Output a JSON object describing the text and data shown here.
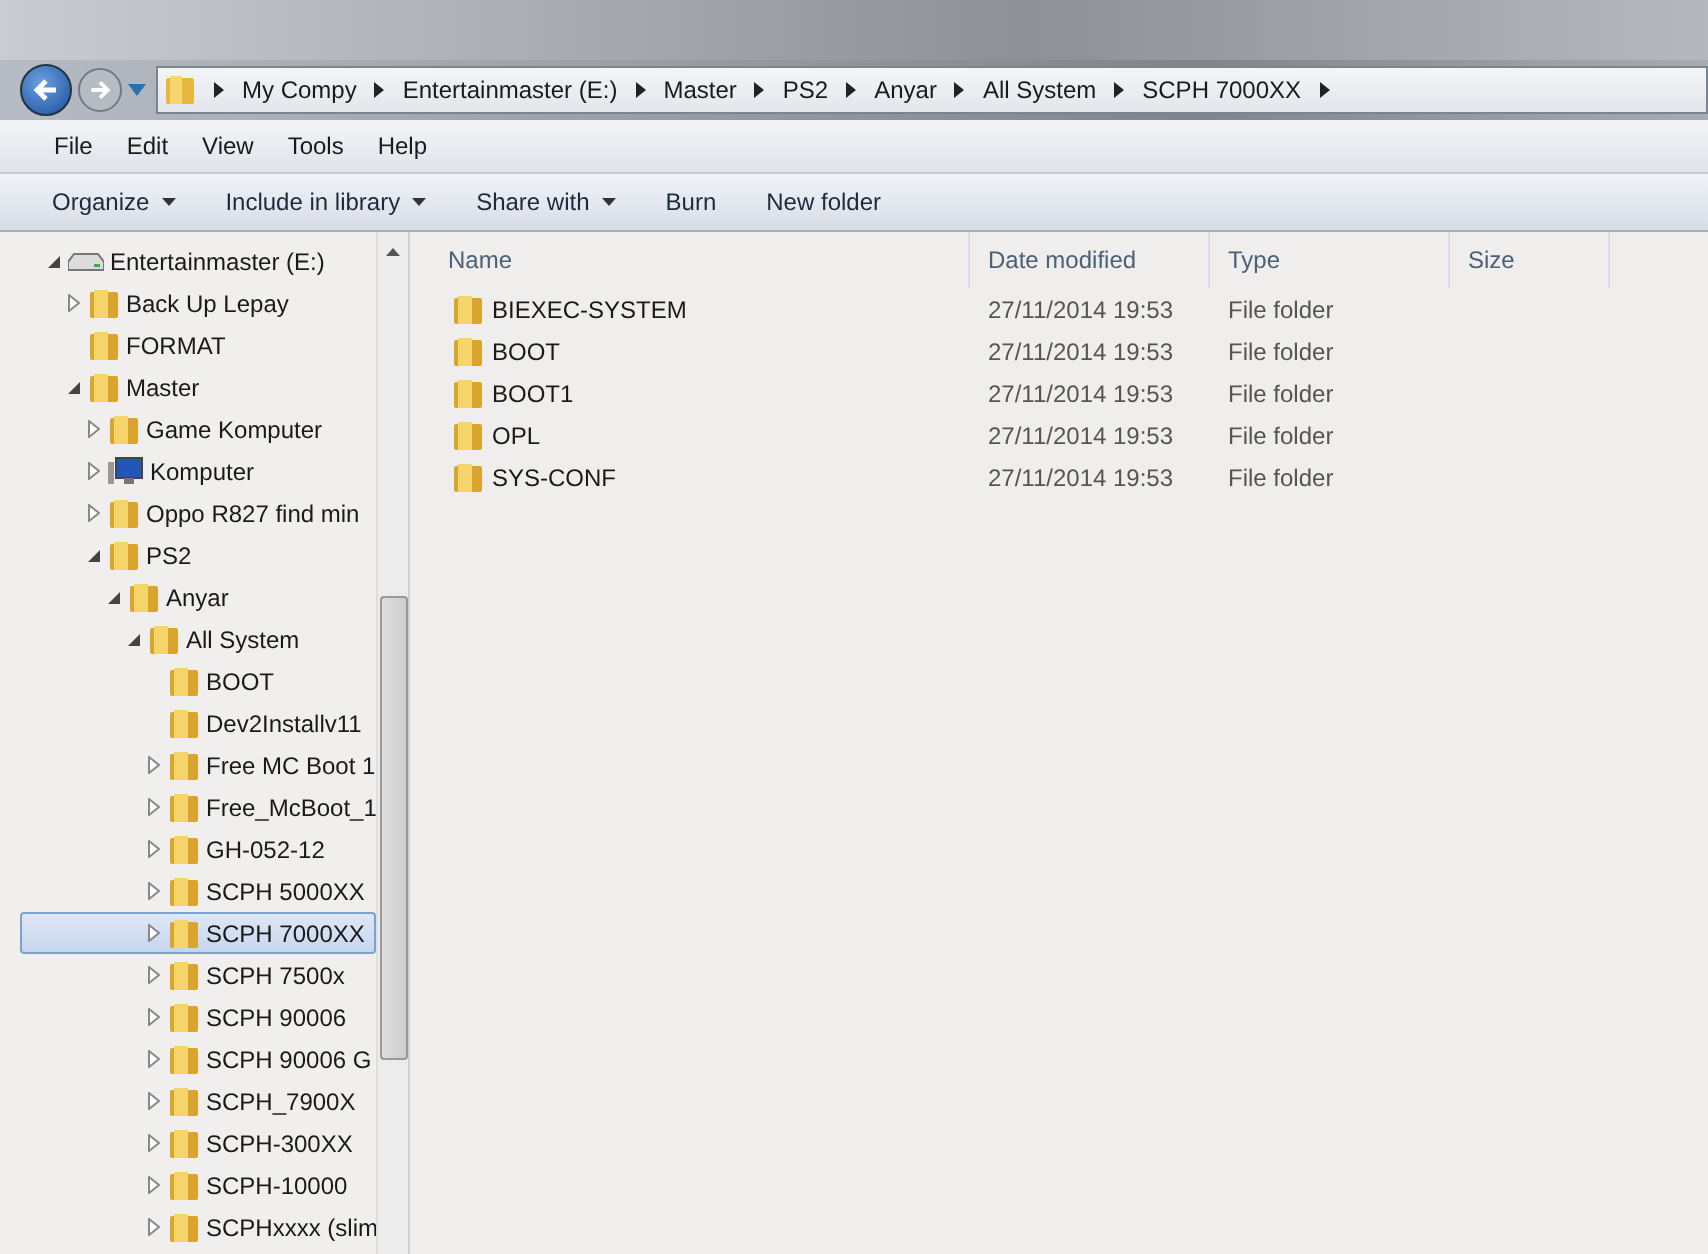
{
  "address_bar": {
    "crumbs": [
      "My Compy",
      "Entertainmaster (E:)",
      "Master",
      "PS2",
      "Anyar",
      "All System",
      "SCPH 7000XX"
    ]
  },
  "menu_bar": [
    "File",
    "Edit",
    "View",
    "Tools",
    "Help"
  ],
  "toolbar": [
    {
      "label": "Organize",
      "dropdown": true
    },
    {
      "label": "Include in library",
      "dropdown": true
    },
    {
      "label": "Share with",
      "dropdown": true
    },
    {
      "label": "Burn",
      "dropdown": false
    },
    {
      "label": "New folder",
      "dropdown": false
    }
  ],
  "tree": [
    {
      "label": "Entertainmaster (E:)",
      "kind": "drive",
      "expanded": true,
      "selected": false,
      "children": [
        {
          "label": "Back Up Lepay",
          "kind": "folder",
          "expanded": false,
          "selected": false
        },
        {
          "label": "FORMAT",
          "kind": "folder",
          "selected": false
        },
        {
          "label": "Master",
          "kind": "folder",
          "expanded": true,
          "selected": false,
          "children": [
            {
              "label": "Game Komputer",
              "kind": "folder",
              "expanded": false,
              "selected": false
            },
            {
              "label": "Komputer",
              "kind": "computer",
              "expanded": false,
              "selected": false
            },
            {
              "label": "Oppo R827 find min",
              "kind": "folder",
              "expanded": false,
              "selected": false
            },
            {
              "label": "PS2",
              "kind": "folder",
              "expanded": true,
              "selected": false,
              "children": [
                {
                  "label": "Anyar",
                  "kind": "folder",
                  "expanded": true,
                  "selected": false,
                  "children": [
                    {
                      "label": "All System",
                      "kind": "folder",
                      "expanded": true,
                      "selected": false,
                      "children": [
                        {
                          "label": "BOOT",
                          "kind": "folder",
                          "selected": false
                        },
                        {
                          "label": "Dev2Installv11",
                          "kind": "folder",
                          "selected": false
                        },
                        {
                          "label": "Free MC Boot 1",
                          "kind": "folder",
                          "expanded": false,
                          "selected": false
                        },
                        {
                          "label": "Free_McBoot_1",
                          "kind": "folder",
                          "expanded": false,
                          "selected": false
                        },
                        {
                          "label": "GH-052-12",
                          "kind": "folder",
                          "expanded": false,
                          "selected": false
                        },
                        {
                          "label": "SCPH 5000XX",
                          "kind": "folder",
                          "expanded": false,
                          "selected": false
                        },
                        {
                          "label": "SCPH 7000XX",
                          "kind": "folder",
                          "expanded": false,
                          "selected": true
                        },
                        {
                          "label": "SCPH 7500x",
                          "kind": "folder",
                          "expanded": false,
                          "selected": false
                        },
                        {
                          "label": "SCPH 90006",
                          "kind": "folder",
                          "expanded": false,
                          "selected": false
                        },
                        {
                          "label": "SCPH 90006 G",
                          "kind": "folder",
                          "expanded": false,
                          "selected": false
                        },
                        {
                          "label": "SCPH_7900X",
                          "kind": "folder",
                          "expanded": false,
                          "selected": false
                        },
                        {
                          "label": "SCPH-300XX",
                          "kind": "folder",
                          "expanded": false,
                          "selected": false
                        },
                        {
                          "label": "SCPH-10000",
                          "kind": "folder",
                          "expanded": false,
                          "selected": false
                        },
                        {
                          "label": "SCPHxxxx (slim",
                          "kind": "folder",
                          "expanded": false,
                          "selected": false
                        }
                      ]
                    }
                  ]
                }
              ]
            }
          ]
        }
      ]
    }
  ],
  "file_list": {
    "columns": [
      "Name",
      "Date modified",
      "Type",
      "Size"
    ],
    "rows": [
      {
        "name": "BIEXEC-SYSTEM",
        "date_modified": "27/11/2014 19:53",
        "type": "File folder"
      },
      {
        "name": "BOOT",
        "date_modified": "27/11/2014 19:53",
        "type": "File folder"
      },
      {
        "name": "BOOT1",
        "date_modified": "27/11/2014 19:53",
        "type": "File folder"
      },
      {
        "name": "OPL",
        "date_modified": "27/11/2014 19:53",
        "type": "File folder"
      },
      {
        "name": "SYS-CONF",
        "date_modified": "27/11/2014 19:53",
        "type": "File folder"
      }
    ]
  }
}
